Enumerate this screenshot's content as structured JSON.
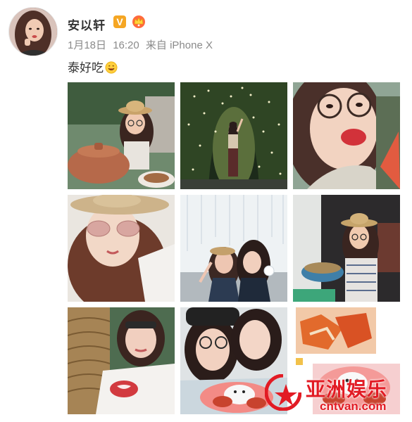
{
  "post": {
    "username": "安以轩",
    "verified_badge": "V",
    "date": "1月18日",
    "time": "16:20",
    "source": "来自 iPhone X",
    "text": "泰好吃",
    "emoji": "smiling-face-emoji"
  },
  "photos": [
    {
      "id": "photo-1",
      "icon": "photo-woman-eating-with-clay-pot"
    },
    {
      "id": "photo-2",
      "icon": "photo-light-tunnel"
    },
    {
      "id": "photo-3",
      "icon": "photo-selfie-pout-glasses"
    },
    {
      "id": "photo-4",
      "icon": "photo-selfie-hat-sunglasses"
    },
    {
      "id": "photo-5",
      "icon": "photo-two-friends-crystal-backdrop"
    },
    {
      "id": "photo-6",
      "icon": "photo-hat-holding-noodle-bowl"
    },
    {
      "id": "photo-7",
      "icon": "photo-sunglasses-rattan-chair"
    },
    {
      "id": "photo-8",
      "icon": "photo-friends-with-rice-plate"
    },
    {
      "id": "photo-9",
      "icon": "photo-food-collage"
    }
  ],
  "watermark": {
    "name": "亚洲娱乐",
    "url": "cntvan.com"
  },
  "colors": {
    "username": "#333333",
    "meta": "#8a8a8a",
    "verified": "#f5a623",
    "watermark": "#e21b24"
  }
}
